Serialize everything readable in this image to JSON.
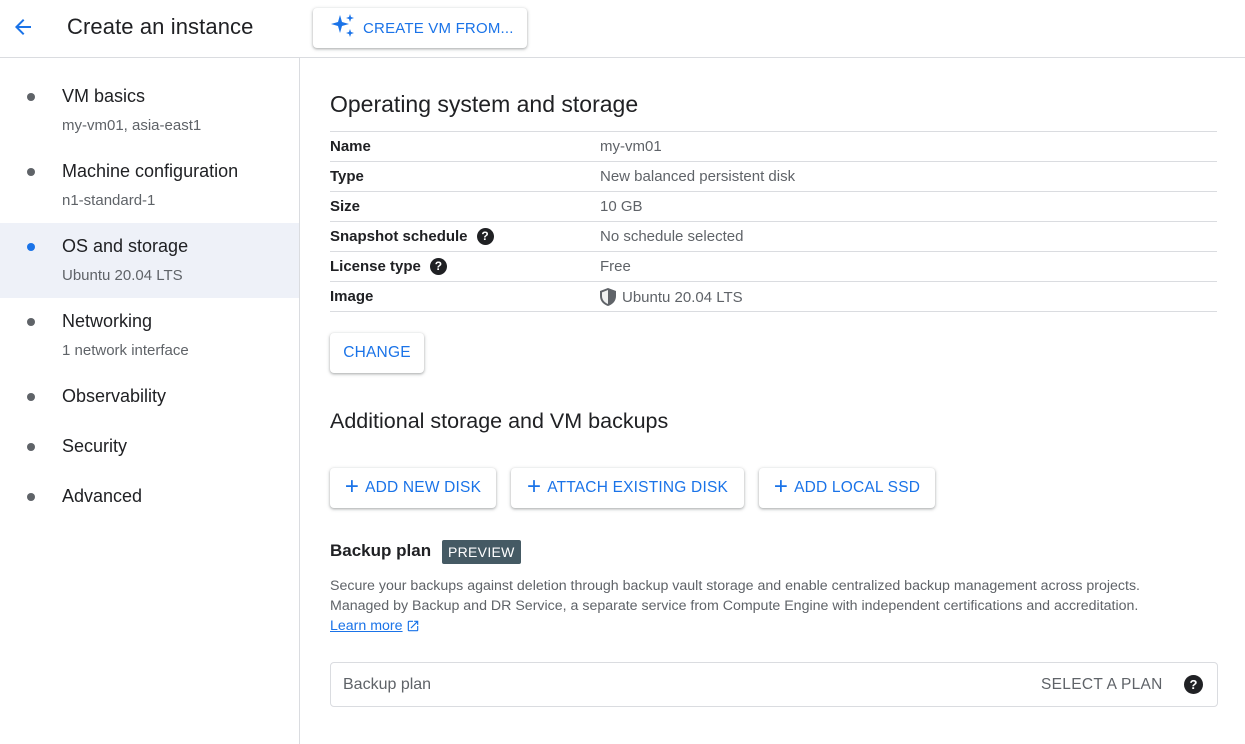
{
  "header": {
    "title": "Create an instance",
    "create_from_label": "CREATE VM FROM..."
  },
  "sidebar": {
    "steps": [
      {
        "title": "VM basics",
        "subtitle": "my-vm01, asia-east1",
        "active": false
      },
      {
        "title": "Machine configuration",
        "subtitle": "n1-standard-1",
        "active": false
      },
      {
        "title": "OS and storage",
        "subtitle": "Ubuntu 20.04 LTS",
        "active": true
      },
      {
        "title": "Networking",
        "subtitle": "1 network interface",
        "active": false
      },
      {
        "title": "Observability",
        "subtitle": "",
        "active": false
      },
      {
        "title": "Security",
        "subtitle": "",
        "active": false
      },
      {
        "title": "Advanced",
        "subtitle": "",
        "active": false
      }
    ]
  },
  "os_storage": {
    "heading": "Operating system and storage",
    "rows": [
      {
        "key": "Name",
        "value": "my-vm01"
      },
      {
        "key": "Type",
        "value": "New balanced persistent disk"
      },
      {
        "key": "Size",
        "value": "10 GB"
      },
      {
        "key": "Snapshot schedule",
        "value": "No schedule selected"
      },
      {
        "key": "License type",
        "value": "Free"
      },
      {
        "key": "Image",
        "value": "Ubuntu 20.04 LTS"
      }
    ],
    "change_label": "CHANGE"
  },
  "additional": {
    "heading": "Additional storage and VM backups",
    "add_new_disk": "ADD NEW DISK",
    "attach_existing_disk": "ATTACH EXISTING DISK",
    "add_local_ssd": "ADD LOCAL SSD"
  },
  "backup": {
    "title": "Backup plan",
    "badge": "PREVIEW",
    "desc_line1": "Secure your backups against deletion through backup vault storage and enable centralized backup management across projects.",
    "desc_line2": "Managed by Backup and DR Service, a separate service from Compute Engine with independent certifications and accreditation.",
    "learn_more": "Learn more",
    "field_placeholder": "Backup plan",
    "select_label": "SELECT A PLAN"
  },
  "colors": {
    "accent": "#1a73e8",
    "active_step_bg": "#eef1f8",
    "badge_bg": "#455a64"
  }
}
